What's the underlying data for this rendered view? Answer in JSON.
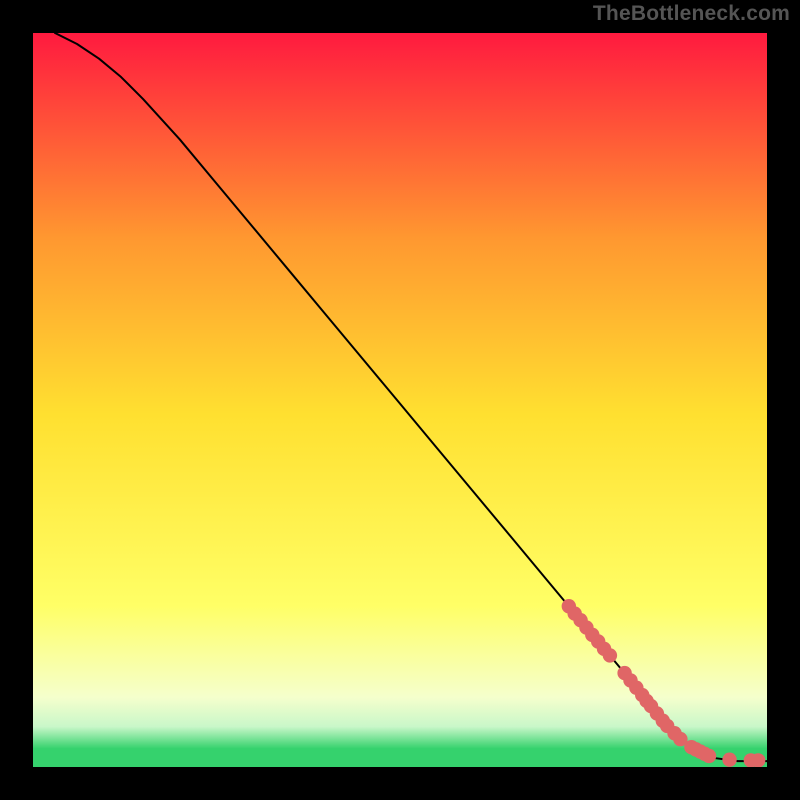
{
  "watermark": {
    "text": "TheBottleneck.com"
  },
  "colors": {
    "frame": "#000000",
    "curve": "#000000",
    "marker": "#e06666",
    "grad_top": "#ff1a3f",
    "grad_mid_upper": "#ff9830",
    "grad_mid": "#ffe030",
    "grad_mid_lower": "#ffff66",
    "grad_pale": "#f5ffcc",
    "grad_green_pale": "#c9f7c9",
    "grad_green": "#35d26d"
  },
  "chart_data": {
    "type": "line",
    "title": "",
    "xlabel": "",
    "ylabel": "",
    "xlim": [
      0,
      100
    ],
    "ylim": [
      0,
      100
    ],
    "series": [
      {
        "name": "curve",
        "x": [
          3,
          6,
          9,
          12,
          15,
          20,
          25,
          30,
          35,
          40,
          45,
          50,
          55,
          60,
          65,
          70,
          75,
          80,
          84,
          87,
          89,
          91,
          93,
          96,
          100
        ],
        "y": [
          100,
          98.5,
          96.5,
          94,
          91,
          85.5,
          79.5,
          73.5,
          67.5,
          61.5,
          55.5,
          49.5,
          43.5,
          37.5,
          31.5,
          25.5,
          19.5,
          13.5,
          8.5,
          5,
          3.2,
          2,
          1.2,
          0.8,
          0.8
        ]
      }
    ],
    "markers": {
      "name": "points",
      "x": [
        73.0,
        73.8,
        74.6,
        75.4,
        76.2,
        77.0,
        77.8,
        78.6,
        80.6,
        81.4,
        82.2,
        83.0,
        83.6,
        84.2,
        85.0,
        85.8,
        86.4,
        87.4,
        88.2,
        89.7,
        90.3,
        90.9,
        91.5,
        92.1,
        94.9,
        97.8,
        98.8
      ],
      "y": [
        21.9,
        20.9,
        20.0,
        19.0,
        18.0,
        17.1,
        16.1,
        15.2,
        12.8,
        11.8,
        10.8,
        9.8,
        9.0,
        8.3,
        7.3,
        6.3,
        5.6,
        4.6,
        3.8,
        2.7,
        2.4,
        2.1,
        1.8,
        1.5,
        1.0,
        0.9,
        0.9
      ]
    }
  }
}
